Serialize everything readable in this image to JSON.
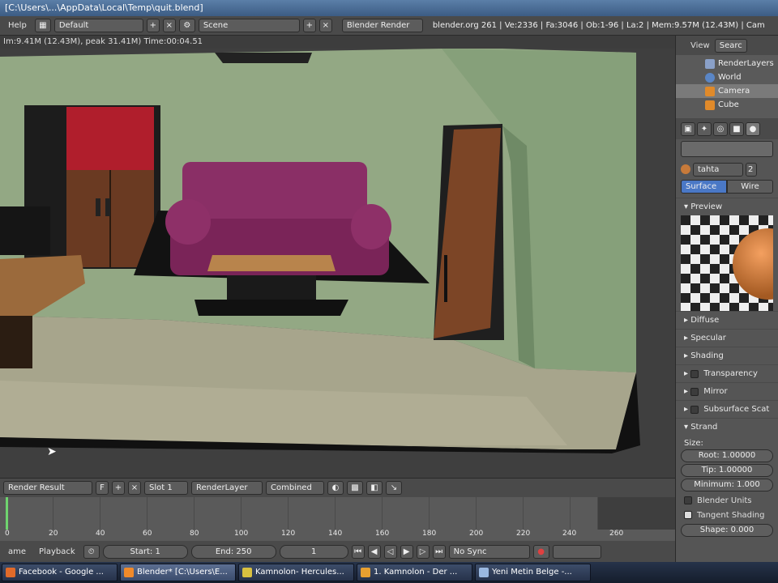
{
  "window": {
    "title": "[C:\\Users\\...\\AppData\\Local\\Temp\\quit.blend]"
  },
  "menubar": {
    "help": "Help",
    "screen_layout": "Default",
    "scene": "Scene",
    "engine": "Blender Render",
    "stats": "blender.org 261 | Ve:2336 | Fa:3046 | Ob:1-96 | La:2 | Mem:9.57M (12.43M) | Cam"
  },
  "render": {
    "info": "Im:9.41M (12.43M), peak 31.41M) Time:00:04.51"
  },
  "image_editor": {
    "image_name": "Render Result",
    "slot": "Slot 1",
    "layer": "RenderLayer",
    "pass": "Combined"
  },
  "timeline": {
    "ticks": [
      "0",
      "20",
      "40",
      "60",
      "80",
      "100",
      "120",
      "140",
      "160",
      "180",
      "200",
      "220",
      "240",
      "260"
    ],
    "view_menu": "ame",
    "playback_menu": "Playback",
    "start": "Start: 1",
    "end": "End: 250",
    "current": "1",
    "sync": "No Sync"
  },
  "outliner": {
    "view": "View",
    "search": "Searc",
    "items": [
      "RenderLayers",
      "World",
      "Camera",
      "Cube"
    ]
  },
  "properties": {
    "material_name": "tahta",
    "users": "2",
    "tabs": [
      "Surface",
      "Wire"
    ],
    "panels": {
      "preview": "Preview",
      "diffuse": "Diffuse",
      "specular": "Specular",
      "shading": "Shading",
      "transparency": "Transparency",
      "mirror": "Mirror",
      "subsurface": "Subsurface Scat",
      "strand": "Strand"
    },
    "strand": {
      "size_label": "Size:",
      "root": "Root: 1.00000",
      "tip": "Tip: 1.00000",
      "minimum": "Minimum: 1.000",
      "blender_units": "Blender Units",
      "tangent_shading": "Tangent Shading",
      "shape": "Shape: 0.000"
    }
  },
  "taskbar": {
    "tasks": [
      "Facebook - Google ...",
      "Blender* [C:\\Users\\E...",
      "Kamnolon- Hercules...",
      "1. Kamnolon - Der ...",
      "Yeni Metin Belge -..."
    ]
  },
  "colors": {
    "wall": "#8fa57e",
    "sofa": "#8a2f66",
    "cabinet": "#6a3a22",
    "accent_blue": "#4a78c6"
  }
}
